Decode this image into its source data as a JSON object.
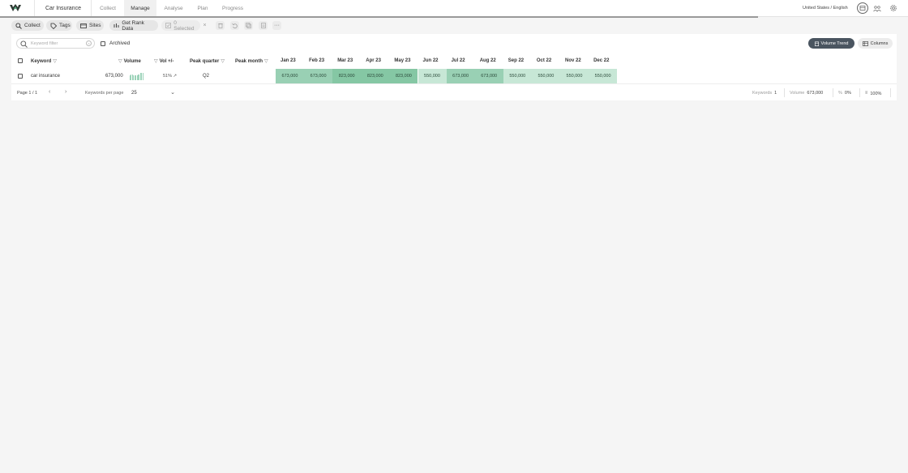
{
  "header": {
    "project": "Car Insurance",
    "tabs": [
      {
        "label": "Collect"
      },
      {
        "label": "Manage"
      },
      {
        "label": "Analyse"
      },
      {
        "label": "Plan"
      },
      {
        "label": "Progress"
      }
    ],
    "active_tab": "Manage",
    "locale": "United States / English",
    "icons": [
      "logo-icon",
      "locale-circle-icon",
      "users-icon",
      "gear-icon"
    ]
  },
  "toolbar": {
    "collect": "Collect",
    "tags": "Tags",
    "sites": "Sites",
    "get_rank_data": "Get Rank Data",
    "selected": "0 Selected"
  },
  "filters": {
    "search_placeholder": "Keyword filter",
    "archived": "Archived",
    "volume_trend": "Volume Trend",
    "columns": "Columns"
  },
  "table": {
    "headers": {
      "keyword": "Keyword",
      "volume": "Volume",
      "vol_change": "Vol +/-",
      "peak_quarter": "Peak quarter",
      "peak_month": "Peak month",
      "months": [
        "Jan 23",
        "Feb 23",
        "Mar 23",
        "Apr 23",
        "May 23",
        "Jun 22",
        "Jul 22",
        "Aug 22",
        "Sep 22",
        "Oct 22",
        "Nov 22",
        "Dec 22"
      ]
    },
    "rows": [
      {
        "keyword": "car insurance",
        "volume": "673,000",
        "vol_change": "51% ↗",
        "peak_quarter": "Q2",
        "peak_month": "",
        "monthly": [
          "673,000",
          "673,000",
          "823,000",
          "823,000",
          "823,000",
          "550,000",
          "673,000",
          "673,000",
          "550,000",
          "550,000",
          "550,000",
          "550,000"
        ],
        "monthly_colors": [
          "#99d0b4",
          "#99d0b4",
          "#85c7a4",
          "#85c7a4",
          "#85c7a4",
          "#c7e7d6",
          "#99d0b4",
          "#99d0b4",
          "#c7e7d6",
          "#c7e7d6",
          "#c7e7d6",
          "#c7e7d6"
        ]
      }
    ]
  },
  "footer": {
    "page": "Page 1 / 1",
    "kpp_label": "Keywords per page",
    "kpp_value": "25",
    "keywords_label": "Keywords",
    "keywords_value": "1",
    "volume_label": "Volume",
    "volume_value": "673,000",
    "percent_value": "0%",
    "filter_value": "100%"
  },
  "colors": {
    "accent_dark": "#4a5560",
    "green_high": "#85c7a4",
    "green_mid": "#99d0b4",
    "green_low": "#c7e7d6"
  }
}
